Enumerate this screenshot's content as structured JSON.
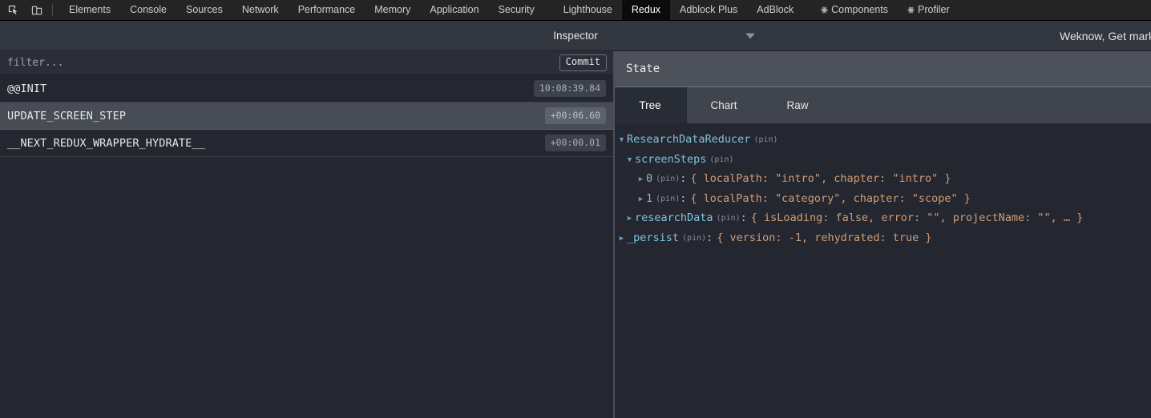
{
  "devtools_toolbar": {
    "icons": [
      {
        "name": "inspect-element-icon",
        "label": "Inspect element"
      },
      {
        "name": "device-toolbar-icon",
        "label": "Toggle device toolbar"
      }
    ],
    "tabs": [
      {
        "label": "Elements",
        "active": false,
        "icon": null
      },
      {
        "label": "Console",
        "active": false,
        "icon": null
      },
      {
        "label": "Sources",
        "active": false,
        "icon": null
      },
      {
        "label": "Network",
        "active": false,
        "icon": null
      },
      {
        "label": "Performance",
        "active": false,
        "icon": null
      },
      {
        "label": "Memory",
        "active": false,
        "icon": null
      },
      {
        "label": "Application",
        "active": false,
        "icon": null
      },
      {
        "label": "Security",
        "active": false,
        "icon": null
      },
      {
        "label": "Lighthouse",
        "active": false,
        "icon": null
      },
      {
        "label": "Redux",
        "active": true,
        "icon": null
      },
      {
        "label": "Adblock Plus",
        "active": false,
        "icon": null
      },
      {
        "label": "AdBlock",
        "active": false,
        "icon": null
      },
      {
        "label": "Components",
        "active": false,
        "icon": "react-atom-icon"
      },
      {
        "label": "Profiler",
        "active": false,
        "icon": "react-atom-icon"
      }
    ]
  },
  "inspector_bar": {
    "title": "Inspector",
    "dropdown_icon": "chevron-down-icon",
    "right_text": "Weknow, Get mark"
  },
  "filter_bar": {
    "placeholder": "filter...",
    "value": "",
    "commit_label": "Commit"
  },
  "actions": [
    {
      "name": "@@INIT",
      "time": "10:08:39.84",
      "selected": false
    },
    {
      "name": "UPDATE_SCREEN_STEP",
      "time": "+00:06.60",
      "selected": true
    },
    {
      "name": "__NEXT_REDUX_WRAPPER_HYDRATE__",
      "time": "+00:00.01",
      "selected": false
    }
  ],
  "state_panel": {
    "header": "State",
    "tabs": [
      {
        "label": "Tree",
        "active": true
      },
      {
        "label": "Chart",
        "active": false
      },
      {
        "label": "Raw",
        "active": false
      }
    ]
  },
  "tree": [
    {
      "indent": 0,
      "arrow": "open",
      "key": "ResearchDataReducer",
      "key_kind": "name",
      "pin": "(pin)",
      "colon": "",
      "preview": ""
    },
    {
      "indent": 1,
      "arrow": "open",
      "key": "screenSteps",
      "key_kind": "name",
      "pin": "(pin)",
      "colon": "",
      "preview": ""
    },
    {
      "indent": 2,
      "arrow": "closed",
      "key": "0",
      "key_kind": "index",
      "pin": "(pin)",
      "colon": ":",
      "preview": "{ localPath: \"intro\", chapter: \"intro\" }"
    },
    {
      "indent": 2,
      "arrow": "closed",
      "key": "1",
      "key_kind": "index",
      "pin": "(pin)",
      "colon": ":",
      "preview": "{ localPath: \"category\", chapter: \"scope\" }"
    },
    {
      "indent": 1,
      "arrow": "closed",
      "key": "researchData",
      "key_kind": "name",
      "pin": "(pin)",
      "colon": ":",
      "preview": "{ isLoading: false, error: \"\", projectName: \"\", … }"
    },
    {
      "indent": 0,
      "arrow": "closed",
      "key": "_persist",
      "key_kind": "name",
      "pin": "(pin)",
      "colon": ":",
      "preview": "{ version: -1, rehydrated: true }"
    }
  ],
  "colors": {
    "toolbar_bg": "#242424",
    "active_tab_bg": "#0b0b0b",
    "panel_bg": "#24272f",
    "header_bg": "#32363f",
    "state_header_bg": "#4d5159",
    "tabs_bg": "#40444d",
    "selected_row_bg": "#474c55",
    "key_color": "#7fc3e3",
    "value_color": "#cf9c78",
    "arrow_color": "#6b98c4"
  }
}
